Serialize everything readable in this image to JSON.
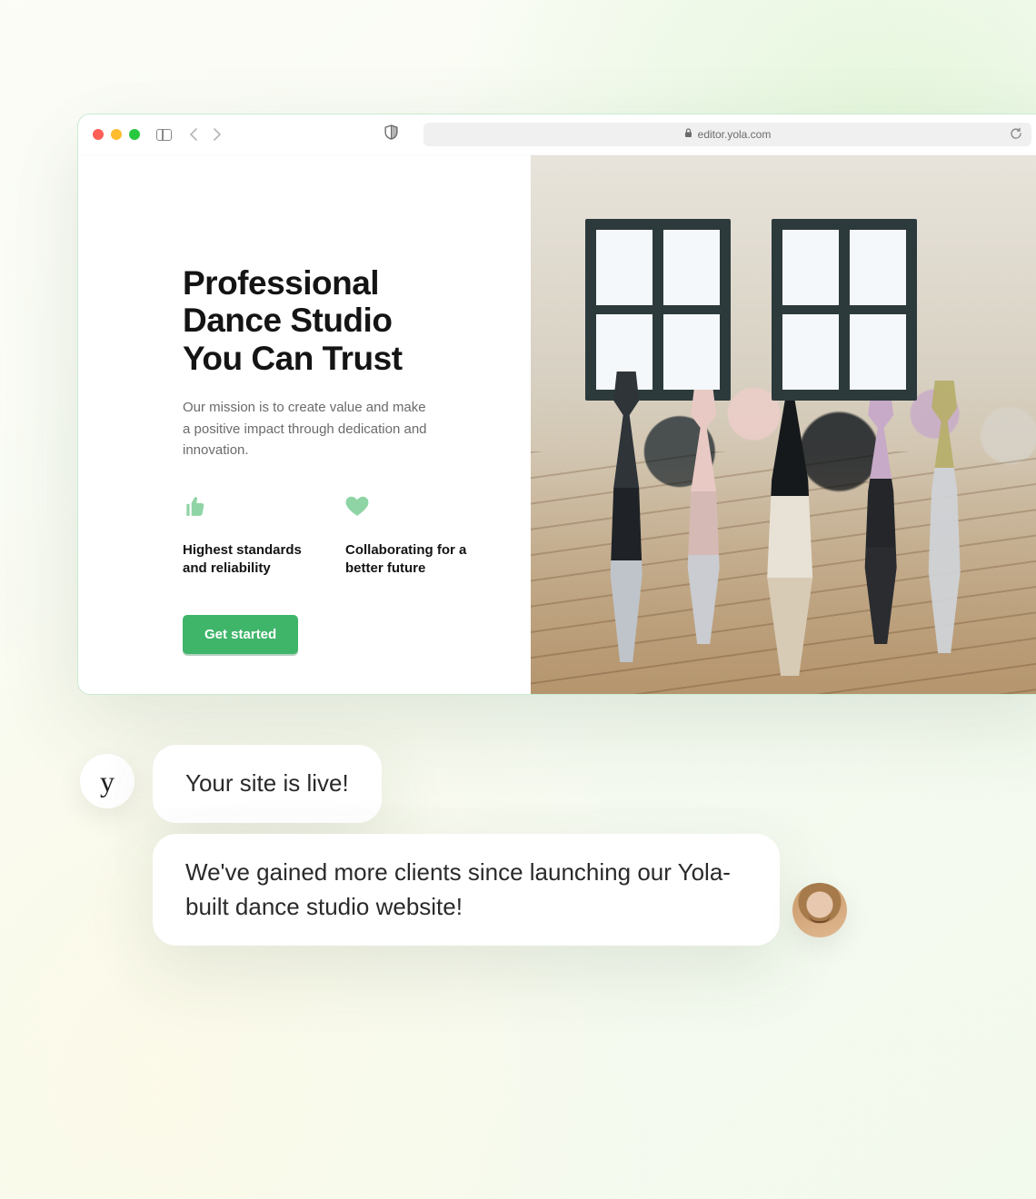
{
  "browser": {
    "url": "editor.yola.com"
  },
  "hero": {
    "title_line1": "Professional",
    "title_line2": "Dance Studio",
    "title_line3": "You Can Trust",
    "mission": "Our mission is to create value and make a positive impact through dedication and innovation.",
    "feature1": "Highest standards and reliability",
    "feature2": "Collaborating for a better future",
    "cta": "Get started"
  },
  "chat": {
    "avatar_glyph": "y",
    "msg1": "Your site is live!",
    "msg2": "We've gained more clients since launching our Yola-built dance studio website!"
  }
}
